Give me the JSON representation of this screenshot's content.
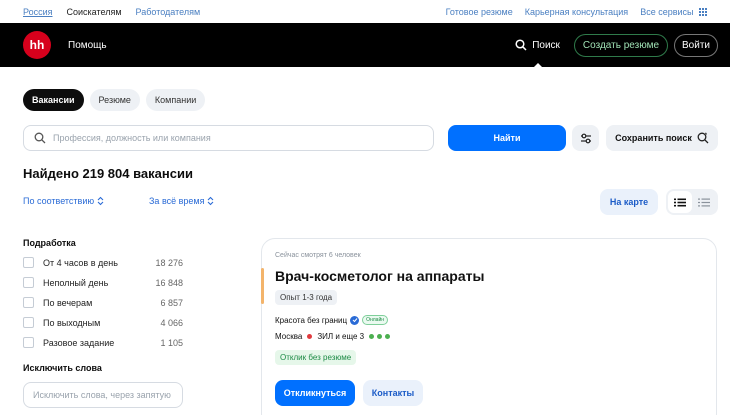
{
  "topbar": {
    "region": "Россия",
    "seekers": "Соискателям",
    "employers": "Работодателям",
    "links": [
      "Готовое резюме",
      "Карьерная консультация",
      "Все сервисы"
    ]
  },
  "header": {
    "logo": "hh",
    "help": "Помощь",
    "search": "Поиск",
    "create_resume": "Создать резюме",
    "login": "Войти"
  },
  "tabs": [
    {
      "label": "Вакансии",
      "active": true
    },
    {
      "label": "Резюме",
      "active": false
    },
    {
      "label": "Компании",
      "active": false
    }
  ],
  "search": {
    "placeholder": "Профессия, должность или компания",
    "find_button": "Найти",
    "save_search": "Сохранить поиск"
  },
  "results": {
    "found": "Найдено 219 804 вакансии",
    "sort_relevance": "По соответствию",
    "sort_period": "За всё время",
    "map_button": "На карте"
  },
  "filters": {
    "side_job_title": "Подработка",
    "items": [
      {
        "label": "От 4 часов в день",
        "count": "18 276"
      },
      {
        "label": "Неполный день",
        "count": "16 848"
      },
      {
        "label": "По вечерам",
        "count": "6 857"
      },
      {
        "label": "По выходным",
        "count": "4 066"
      },
      {
        "label": "Разовое задание",
        "count": "1 105"
      }
    ],
    "exclude_title": "Исключить слова",
    "exclude_placeholder": "Исключить слова, через запятую"
  },
  "vacancy": {
    "watching": "Сейчас смотрят 6 человек",
    "title": "Врач-косметолог на аппараты",
    "experience": "Опыт 1-3 года",
    "company": "Красота без границ",
    "online_badge": "Онлайн",
    "city": "Москва",
    "metro": "ЗИЛ и еще 3",
    "no_resume": "Отклик без резюме",
    "apply": "Откликнуться",
    "contacts": "Контакты"
  },
  "colors": {
    "brand_red": "#d6001c",
    "primary_blue": "#0070ff",
    "header_bg": "#000000",
    "metro_red": "#e03a3e",
    "metro_green": "#4caf50"
  }
}
